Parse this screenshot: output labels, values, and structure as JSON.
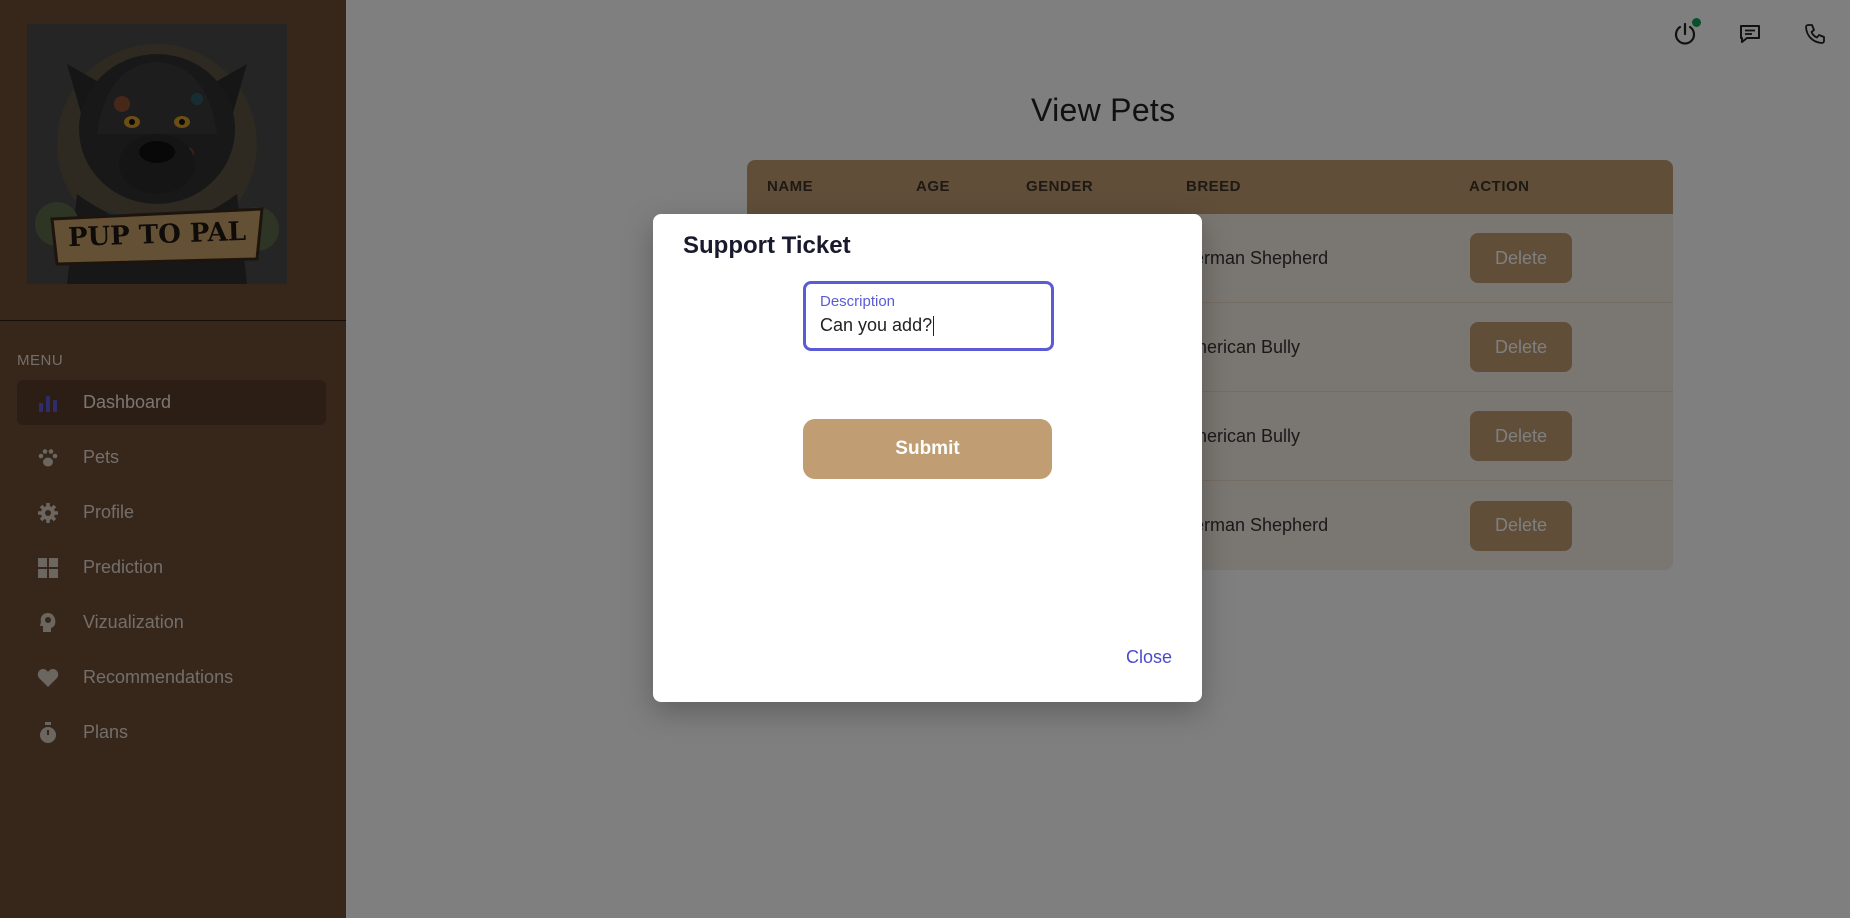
{
  "sidebar": {
    "logo_text": "PUP TO PAL",
    "menu_heading": "MENU",
    "items": [
      {
        "label": "Dashboard",
        "icon": "bar-chart-icon",
        "active": true
      },
      {
        "label": "Pets",
        "icon": "paw-icon"
      },
      {
        "label": "Profile",
        "icon": "gear-icon"
      },
      {
        "label": "Prediction",
        "icon": "grid-icon"
      },
      {
        "label": "Vizualization",
        "icon": "head-gear-icon"
      },
      {
        "label": "Recommendations",
        "icon": "heart-icon"
      },
      {
        "label": "Plans",
        "icon": "stopwatch-icon"
      }
    ]
  },
  "topbar": {
    "icons": [
      "power-icon",
      "chat-icon",
      "phone-icon"
    ],
    "status_color": "#12a05a"
  },
  "main": {
    "title": "View Pets",
    "table": {
      "headers": [
        "NAME",
        "AGE",
        "GENDER",
        "BREED",
        "ACTION"
      ],
      "rows": [
        {
          "breed": "German Shepherd",
          "action": "Delete"
        },
        {
          "breed": "American Bully",
          "action": "Delete"
        },
        {
          "breed": "American Bully",
          "action": "Delete"
        },
        {
          "breed": "German Shepherd",
          "action": "Delete"
        }
      ]
    }
  },
  "modal": {
    "title": "Support Ticket",
    "description_label": "Description",
    "description_value": "Can you add?",
    "submit_label": "Submit",
    "close_label": "Close"
  },
  "colors": {
    "sidebar": "#6f4e37",
    "accent": "#c09d73",
    "focus": "#5b5bd6"
  }
}
